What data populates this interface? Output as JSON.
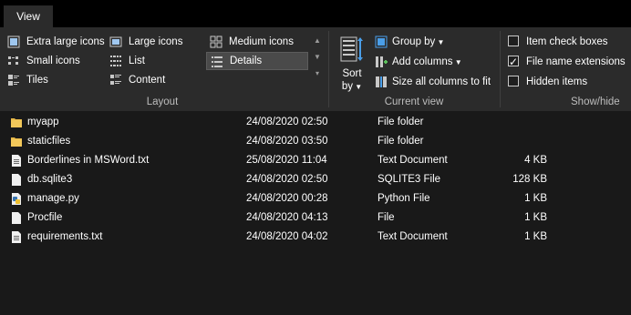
{
  "tabs": {
    "view": "View"
  },
  "layout_group": {
    "label": "Layout",
    "items": [
      {
        "label": "Extra large icons",
        "icon": "extra-large-icons-icon"
      },
      {
        "label": "Large icons",
        "icon": "large-icons-icon"
      },
      {
        "label": "Medium icons",
        "icon": "medium-icons-icon"
      },
      {
        "label": "Small icons",
        "icon": "small-icons-icon"
      },
      {
        "label": "List",
        "icon": "list-icon"
      },
      {
        "label": "Details",
        "icon": "details-icon",
        "selected": true
      },
      {
        "label": "Tiles",
        "icon": "tiles-icon"
      },
      {
        "label": "Content",
        "icon": "content-icon"
      }
    ]
  },
  "current_view_group": {
    "label": "Current view",
    "sort_by": "Sort",
    "sort_by_2": "by",
    "group_by": "Group by",
    "add_columns": "Add columns",
    "size_all_columns": "Size all columns to fit"
  },
  "show_hide_group": {
    "label": "Show/hide",
    "item_check_boxes": {
      "label": "Item check boxes",
      "checked": false
    },
    "file_name_extensions": {
      "label": "File name extensions",
      "checked": true
    },
    "hidden_items": {
      "label": "Hidden items",
      "checked": false
    }
  },
  "files": [
    {
      "name": "myapp",
      "date": "24/08/2020 02:50",
      "type": "File folder",
      "size": "",
      "icon": "folder-icon"
    },
    {
      "name": "staticfiles",
      "date": "24/08/2020 03:50",
      "type": "File folder",
      "size": "",
      "icon": "folder-icon"
    },
    {
      "name": "Borderlines in MSWord.txt",
      "date": "25/08/2020 11:04",
      "type": "Text Document",
      "size": "4 KB",
      "icon": "text-file-icon"
    },
    {
      "name": "db.sqlite3",
      "date": "24/08/2020 02:50",
      "type": "SQLITE3 File",
      "size": "128 KB",
      "icon": "file-icon"
    },
    {
      "name": "manage.py",
      "date": "24/08/2020 00:28",
      "type": "Python File",
      "size": "1 KB",
      "icon": "python-file-icon"
    },
    {
      "name": "Procfile",
      "date": "24/08/2020 04:13",
      "type": "File",
      "size": "1 KB",
      "icon": "file-icon"
    },
    {
      "name": "requirements.txt",
      "date": "24/08/2020 04:02",
      "type": "Text Document",
      "size": "1 KB",
      "icon": "text-file-icon"
    }
  ],
  "colors": {
    "background": "#191919",
    "ribbon": "#2b2b2b",
    "folder": "#e8b94a",
    "accent": "#4a9ee8"
  }
}
